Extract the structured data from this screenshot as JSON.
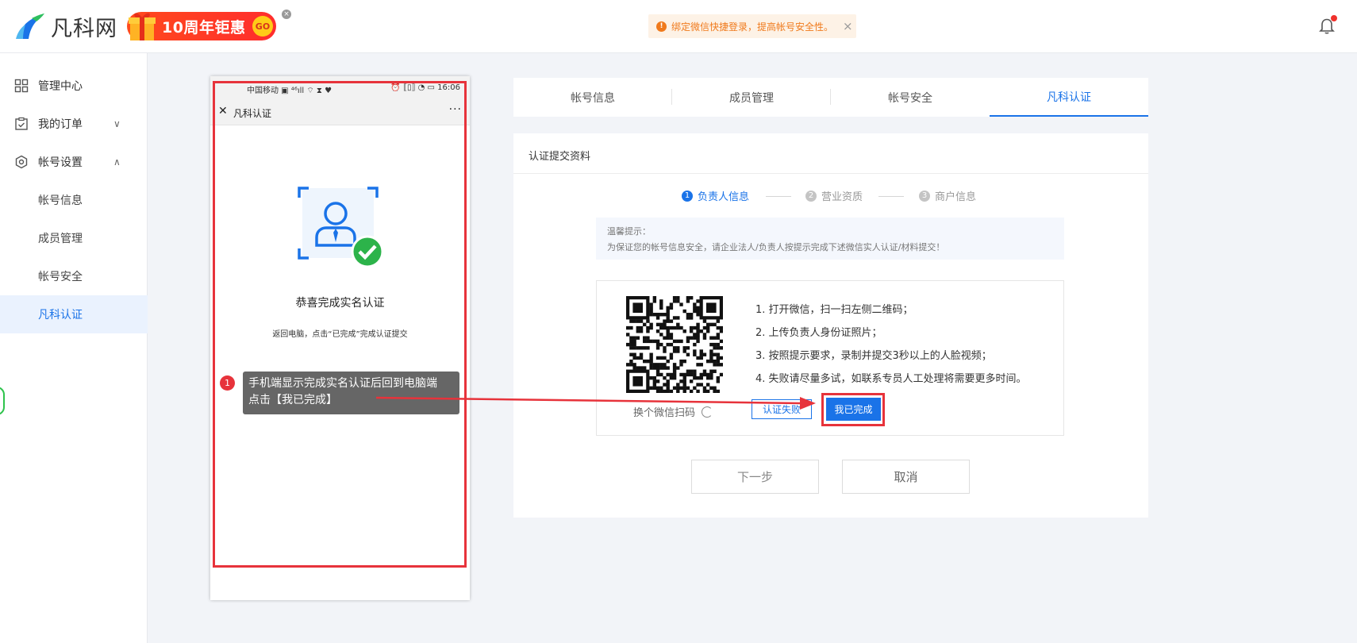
{
  "header": {
    "logo_text": "凡科网",
    "promo_text": "10周年钜惠",
    "promo_go": "GO",
    "promo_close": "×",
    "notice_icon": "!",
    "notice_text": "绑定微信快捷登录，提高帐号安全性。",
    "notice_close": "×",
    "colors": {
      "accent": "#1a73e8",
      "notice": "#f07a1c",
      "highlight": "#e7333b"
    }
  },
  "sidebar": {
    "items": [
      {
        "label": "管理中心",
        "icon": "grid-icon"
      },
      {
        "label": "我的订单",
        "icon": "order-icon",
        "chevron": "∨"
      },
      {
        "label": "帐号设置",
        "icon": "settings-icon",
        "chevron": "∧"
      }
    ],
    "sub_items": [
      {
        "label": "帐号信息"
      },
      {
        "label": "成员管理"
      },
      {
        "label": "帐号安全"
      },
      {
        "label": "凡科认证"
      }
    ]
  },
  "phone": {
    "status_left": "中国移动 ▣ ⁴⁶ıll ⌔ ⧗ ♥",
    "status_right": "⏰ ⟦▯⟧ ◔ ▭ 16:06",
    "close": "✕",
    "title": "凡科认证",
    "more": "···",
    "success_title": "恭喜完成实名认证",
    "success_sub": "返回电脑，点击“已完成”完成认证提交"
  },
  "annotation": {
    "badge": "1",
    "tooltip_line1": "手机端显示完成实名认证后回到电脑端",
    "tooltip_line2": "点击【我已完成】"
  },
  "tabs": [
    {
      "label": "帐号信息"
    },
    {
      "label": "成员管理"
    },
    {
      "label": "帐号安全"
    },
    {
      "label": "凡科认证"
    }
  ],
  "card": {
    "title": "认证提交资料",
    "steps": [
      {
        "num": "1",
        "label": "负责人信息"
      },
      {
        "num": "2",
        "label": "营业资质"
      },
      {
        "num": "3",
        "label": "商户信息"
      }
    ],
    "tip_title": "温馨提示：",
    "tip_text": "为保证您的帐号信息安全，请企业法人/负责人按提示完成下述微信实人认证/材料提交！",
    "qr_switch": "换个微信扫码",
    "instructions": [
      "1. 打开微信，扫一扫左侧二维码；",
      "2. 上传负责人身份证照片；",
      "3. 按照提示要求，录制并提交3秒以上的人脸视频；",
      "4. 失败请尽量多试，如联系专员人工处理将需要更多时间。"
    ],
    "btn_fail": "认证失败",
    "btn_done": "我已完成",
    "btn_next": "下一步",
    "btn_cancel": "取消"
  }
}
